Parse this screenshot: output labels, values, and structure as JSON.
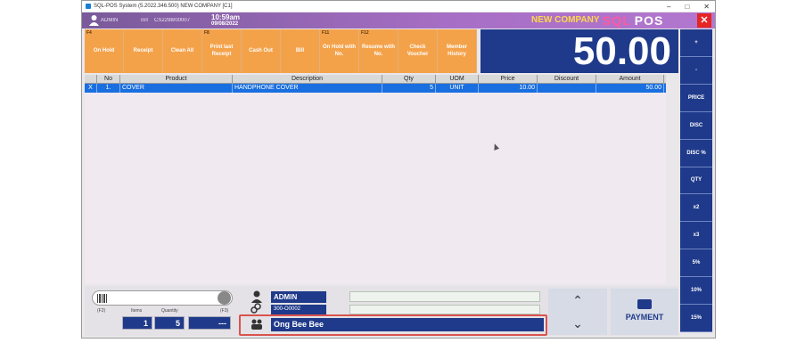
{
  "window": {
    "title": "SQL-POS System (5.2022.346.500) NEW COMPANY [C1]",
    "controls": [
      "–",
      "□",
      "✕"
    ]
  },
  "header": {
    "user": "ADMIN",
    "bill_label": "Bill",
    "bill_no": "CS2298/00007",
    "time": "10:59am",
    "date": "09/08/2022",
    "company": "NEW COMPANY",
    "logo_sql": "SQL",
    "logo_pos": "POS",
    "close": "✕"
  },
  "fkeys": [
    {
      "key": "F4",
      "label": "On Hold"
    },
    {
      "key": "",
      "label": "Receipt"
    },
    {
      "key": "",
      "label": "Clean All"
    },
    {
      "key": "F8",
      "label": "Print last Receipt"
    },
    {
      "key": "",
      "label": "Cash Out"
    },
    {
      "key": "",
      "label": "Bill"
    },
    {
      "key": "F11",
      "label": "On Hold with No."
    },
    {
      "key": "F12",
      "label": "Resume with No."
    },
    {
      "key": "",
      "label": "Check Voucher"
    },
    {
      "key": "",
      "label": "Member History"
    }
  ],
  "total": "50.00",
  "right_buttons": [
    "+",
    "-",
    "PRICE",
    "DISC",
    "DISC %",
    "QTY",
    "x2",
    "x3",
    "5%",
    "10%",
    "15%"
  ],
  "grid": {
    "headers": [
      "",
      "No",
      "Product",
      "Description",
      "Qty",
      "UOM",
      "Price",
      "Discount",
      "Amount"
    ],
    "rows": [
      [
        "X",
        "1.",
        "COVER",
        "HANDPHONE COVER",
        "5",
        "UNIT",
        "10.00",
        "",
        "50.00"
      ]
    ]
  },
  "bottom": {
    "f2": "(F2)",
    "items_label": "Items",
    "quantity_label": "Quantity",
    "f3": "(F3)",
    "items": "1",
    "quantity": "5",
    "extra": "---",
    "admin": "ADMIN",
    "account": "300-O0002",
    "customer": "Ong Bee Bee",
    "up": "⌃",
    "down": "⌄",
    "payment": "PAYMENT"
  },
  "colors": {
    "accent": "#1f3a8a",
    "fkey": "#f4a24a",
    "selected_row": "#1a6fe0",
    "header": "#a86fc6"
  }
}
